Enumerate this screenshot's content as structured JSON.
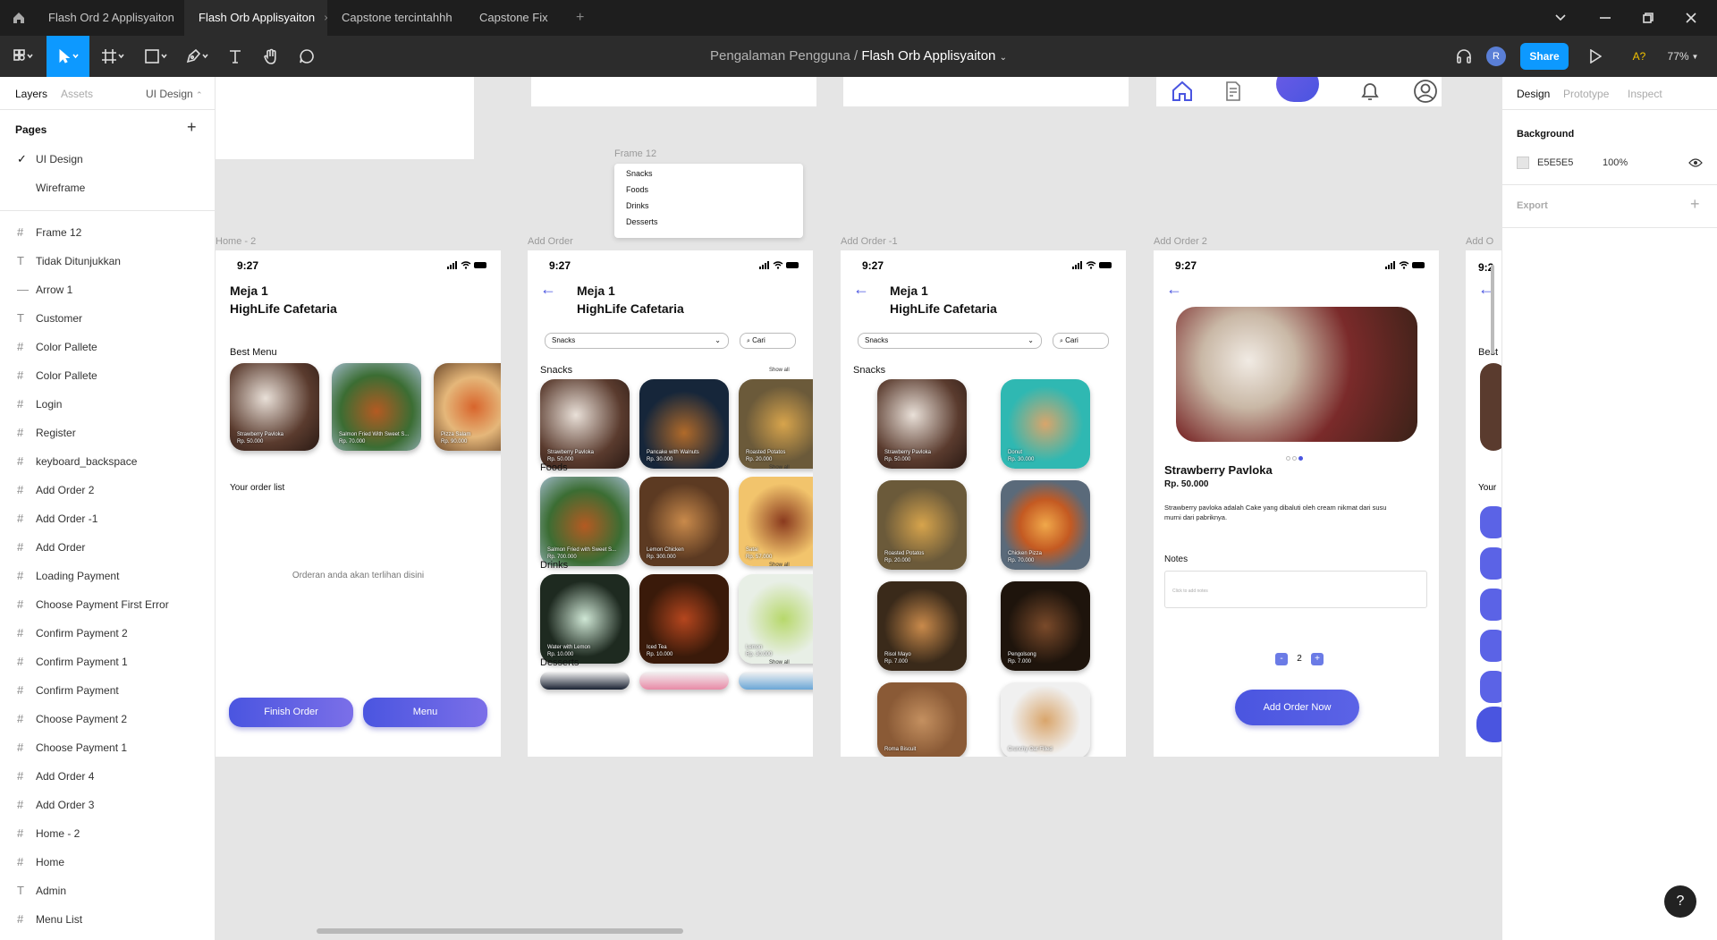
{
  "tabs": [
    {
      "label": "Flash Ord 2 Applisyaiton"
    },
    {
      "label": "Flash Orb Applisyaiton",
      "close": "×"
    },
    {
      "label": "Capstone tercintahhh"
    },
    {
      "label": "Capstone Fix"
    }
  ],
  "tabs_add": "+",
  "breadcrumb": {
    "project": "Pengalaman Pengguna",
    "sep": "/",
    "file": "Flash Orb Applisyaiton"
  },
  "toolbar": {
    "avatar": "R",
    "share": "Share",
    "a_badge": "A?",
    "zoom": "77%"
  },
  "left_panel": {
    "tabs": {
      "layers": "Layers",
      "assets": "Assets",
      "page_select": "UI Design"
    },
    "pages_title": "Pages",
    "pages": [
      {
        "label": "UI Design",
        "check": "✓"
      },
      {
        "label": "Wireframe"
      }
    ],
    "layers": [
      {
        "icon": "#",
        "label": "Frame 12"
      },
      {
        "icon": "T",
        "label": "Tidak Ditunjukkan"
      },
      {
        "icon": "—",
        "label": "Arrow 1"
      },
      {
        "icon": "T",
        "label": "Customer"
      },
      {
        "icon": "#",
        "label": "Color Pallete"
      },
      {
        "icon": "#",
        "label": "Color Pallete"
      },
      {
        "icon": "#",
        "label": "Login"
      },
      {
        "icon": "#",
        "label": "Register"
      },
      {
        "icon": "#",
        "label": "keyboard_backspace"
      },
      {
        "icon": "#",
        "label": "Add Order 2"
      },
      {
        "icon": "#",
        "label": "Add Order -1"
      },
      {
        "icon": "#",
        "label": "Add Order"
      },
      {
        "icon": "#",
        "label": "Loading Payment"
      },
      {
        "icon": "#",
        "label": "Choose Payment First Error"
      },
      {
        "icon": "#",
        "label": "Confirm Payment 2"
      },
      {
        "icon": "#",
        "label": "Confirm Payment 1"
      },
      {
        "icon": "#",
        "label": "Confirm Payment"
      },
      {
        "icon": "#",
        "label": "Choose Payment 2"
      },
      {
        "icon": "#",
        "label": "Choose Payment 1"
      },
      {
        "icon": "#",
        "label": "Add Order 4"
      },
      {
        "icon": "#",
        "label": "Add Order 3"
      },
      {
        "icon": "#",
        "label": "Home - 2"
      },
      {
        "icon": "#",
        "label": "Home"
      },
      {
        "icon": "T",
        "label": "Admin"
      },
      {
        "icon": "#",
        "label": "Menu List"
      }
    ]
  },
  "right_panel": {
    "tabs": {
      "design": "Design",
      "prototype": "Prototype",
      "inspect": "Inspect"
    },
    "background_title": "Background",
    "bg_hex": "E5E5E5",
    "bg_opacity": "100%",
    "export_title": "Export",
    "export_add": "+"
  },
  "canvas_bg": "#E5E5E5",
  "help": "?",
  "frame12": {
    "label": "Frame 12",
    "items": [
      "Snacks",
      "Foods",
      "Drinks",
      "Desserts"
    ]
  },
  "frame_labels": {
    "home2": "Home - 2",
    "add_order": "Add Order",
    "add_order_1": "Add Order -1",
    "add_order_2": "Add Order 2",
    "partial": "Add O"
  },
  "phone": {
    "time": "9:27",
    "title1": "Meja 1",
    "title2": "HighLife Cafetaria",
    "arrow": "←"
  },
  "home2": {
    "best_menu": "Best Menu",
    "cards": [
      {
        "name": "Strawberry Pavloka",
        "price": "Rp. 50.000"
      },
      {
        "name": "Salmon Fried With Sweet S...",
        "price": "Rp. 70.000"
      },
      {
        "name": "Pizza Salam",
        "price": "Rp. 90.000"
      }
    ],
    "order_list": "Your order list",
    "empty": "Orderan anda akan terlihan disini",
    "finish": "Finish Order",
    "menu": "Menu"
  },
  "add_order": {
    "dropdown": "Snacks",
    "search": "Cari",
    "show_all": "Show all",
    "sections": [
      {
        "title": "Snacks",
        "items": [
          {
            "name": "Strawberry Pavloka",
            "price": "Rp. 50.000"
          },
          {
            "name": "Pancake with Walnuts",
            "price": "Rp. 30.000"
          },
          {
            "name": "Roasted Potatos",
            "price": "Rp. 20.000"
          }
        ]
      },
      {
        "title": "Foods",
        "items": [
          {
            "name": "Salmon Fried with Sweet S...",
            "price": "Rp. 700.000"
          },
          {
            "name": "Lemon Chicken",
            "price": "Rp. 300.000"
          },
          {
            "name": "Satai",
            "price": "Rp. 57.000"
          }
        ]
      },
      {
        "title": "Drinks",
        "items": [
          {
            "name": "Water with Lemon",
            "price": "Rp. 10.000"
          },
          {
            "name": "Iced Tea",
            "price": "Rp. 10.000"
          },
          {
            "name": "Lemon",
            "price": "Rp. 30.000"
          }
        ]
      },
      {
        "title": "Desserts",
        "items": []
      }
    ]
  },
  "add_order_1": {
    "dropdown": "Snacks",
    "search": "Cari",
    "section": "Snacks",
    "items": [
      {
        "name": "Strawberry Pavloka",
        "price": "Rp. 50.000"
      },
      {
        "name": "Donut",
        "price": "Rp. 30.000"
      },
      {
        "name": "Roasted Potatos",
        "price": "Rp. 20.000"
      },
      {
        "name": "Chicken Pizza",
        "price": "Rp. 70.000"
      },
      {
        "name": "Risol Mayo",
        "price": "Rp. 7.000"
      },
      {
        "name": "Pengolsong",
        "price": "Rp. 7.000"
      },
      {
        "name": "Roma Biscuit",
        "price": ""
      },
      {
        "name": "Crunchy Oat Filled",
        "price": ""
      }
    ]
  },
  "add_order_2": {
    "name": "Strawberry Pavloka",
    "price": "Rp. 50.000",
    "desc": "Strawberry pavloka adalah Cake yang dibaluti oleh cream nikmat dari susu murni dari pabriknya.",
    "notes": "Notes",
    "notes_placeholder": "Click to add notes",
    "minus": "-",
    "qty": "2",
    "plus": "+",
    "add": "Add Order Now"
  },
  "colors": {
    "accent": "#0D99FF",
    "brand_purple": "#4A55E0",
    "gradient_start": "#6B5BE6"
  }
}
